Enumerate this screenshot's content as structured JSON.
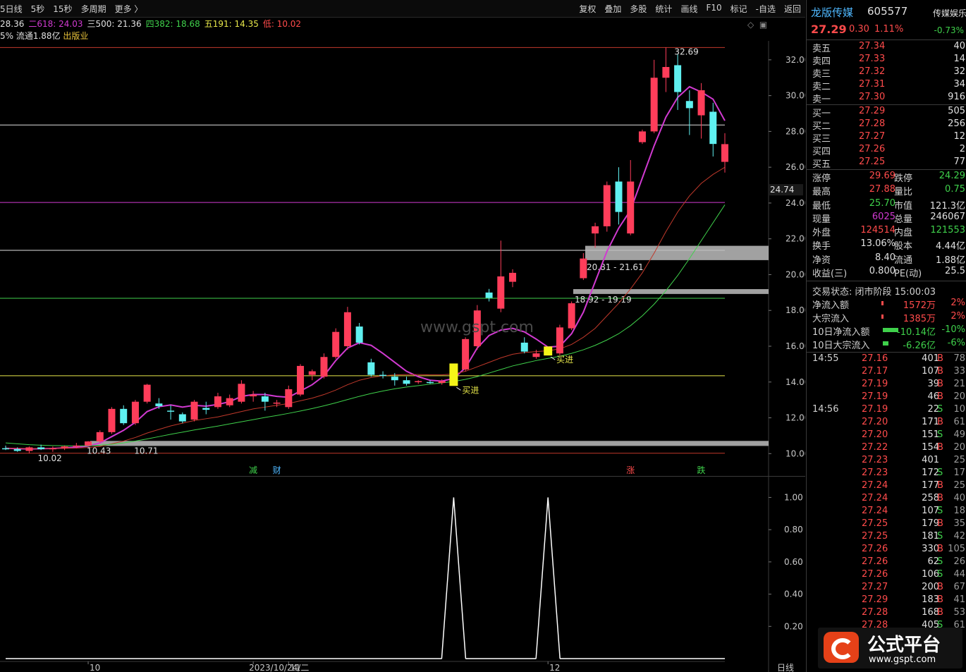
{
  "topbar": {
    "periods": [
      "5日线",
      "5秒",
      "15秒",
      "多周期",
      "更多 〉"
    ],
    "actions": [
      "复权",
      "叠加",
      "多股",
      "统计",
      "画线",
      "F10",
      "标记",
      "-自选",
      "返回"
    ]
  },
  "ma_line": [
    {
      "text": "28.36",
      "color": "#e0e0e0"
    },
    {
      "text": "二618: 24.03",
      "color": "#d13ad1"
    },
    {
      "text": "三500: 21.36",
      "color": "#e0e0e0"
    },
    {
      "text": "四382: 18.68",
      "color": "#3fd14b"
    },
    {
      "text": "五191: 14.35",
      "color": "#e8e84a"
    },
    {
      "text": "低: 10.02",
      "color": "#ff4b4b"
    }
  ],
  "info_line": {
    "text1": "5% 流通1.88亿",
    "text2": "出版业"
  },
  "watermark": "www.gspt.com",
  "chart_data": {
    "type": "candlestick",
    "y_axis_ticks": [
      "32.00",
      "30.00",
      "28.00",
      "26.00",
      "24.00",
      "22.00",
      "20.00",
      "18.00",
      "16.00",
      "14.00",
      "12.00",
      "10.00"
    ],
    "ylim": [
      9.5,
      32.9
    ],
    "price_marker": "24.74",
    "candles": [
      {
        "o": 10.3,
        "h": 10.45,
        "l": 10.2,
        "c": 10.25
      },
      {
        "o": 10.25,
        "h": 10.35,
        "l": 10.1,
        "c": 10.15
      },
      {
        "o": 10.15,
        "h": 10.4,
        "l": 10.02,
        "c": 10.35
      },
      {
        "o": 10.35,
        "h": 10.5,
        "l": 10.2,
        "c": 10.25
      },
      {
        "o": 10.25,
        "h": 10.4,
        "l": 10.1,
        "c": 10.3
      },
      {
        "o": 10.3,
        "h": 10.45,
        "l": 10.2,
        "c": 10.4
      },
      {
        "o": 10.4,
        "h": 10.6,
        "l": 10.3,
        "c": 10.45
      },
      {
        "o": 10.45,
        "h": 10.7,
        "l": 10.43,
        "c": 10.68
      },
      {
        "o": 10.68,
        "h": 11.3,
        "l": 10.6,
        "c": 11.2
      },
      {
        "o": 11.2,
        "h": 12.6,
        "l": 11.1,
        "c": 12.5
      },
      {
        "o": 12.5,
        "h": 12.7,
        "l": 11.6,
        "c": 11.7
      },
      {
        "o": 11.7,
        "h": 13.0,
        "l": 11.6,
        "c": 12.9
      },
      {
        "o": 12.9,
        "h": 13.9,
        "l": 12.8,
        "c": 13.85
      },
      {
        "o": 12.8,
        "h": 13.1,
        "l": 12.5,
        "c": 12.65
      },
      {
        "o": 12.4,
        "h": 12.7,
        "l": 11.9,
        "c": 12.35
      },
      {
        "o": 12.2,
        "h": 12.3,
        "l": 11.7,
        "c": 11.8
      },
      {
        "o": 11.9,
        "h": 13.0,
        "l": 11.8,
        "c": 12.9
      },
      {
        "o": 12.55,
        "h": 12.9,
        "l": 12.2,
        "c": 12.45
      },
      {
        "o": 12.6,
        "h": 13.4,
        "l": 12.5,
        "c": 13.2
      },
      {
        "o": 12.7,
        "h": 13.3,
        "l": 12.6,
        "c": 13.1
      },
      {
        "o": 12.9,
        "h": 14.1,
        "l": 12.8,
        "c": 13.9
      },
      {
        "o": 13.2,
        "h": 13.5,
        "l": 12.9,
        "c": 13.3
      },
      {
        "o": 13.2,
        "h": 13.4,
        "l": 12.4,
        "c": 12.9
      },
      {
        "o": 12.8,
        "h": 13.0,
        "l": 12.6,
        "c": 12.85
      },
      {
        "o": 12.6,
        "h": 13.8,
        "l": 12.5,
        "c": 13.6
      },
      {
        "o": 13.3,
        "h": 15.0,
        "l": 13.2,
        "c": 14.9
      },
      {
        "o": 14.4,
        "h": 14.7,
        "l": 14.1,
        "c": 14.6
      },
      {
        "o": 14.3,
        "h": 15.6,
        "l": 14.2,
        "c": 15.4
      },
      {
        "o": 15.4,
        "h": 17.0,
        "l": 15.3,
        "c": 16.8
      },
      {
        "o": 16.0,
        "h": 18.2,
        "l": 15.8,
        "c": 17.9
      },
      {
        "o": 17.1,
        "h": 17.3,
        "l": 16.1,
        "c": 16.2
      },
      {
        "o": 15.1,
        "h": 15.3,
        "l": 14.3,
        "c": 14.4
      },
      {
        "o": 14.4,
        "h": 14.6,
        "l": 14.2,
        "c": 14.35
      },
      {
        "o": 14.3,
        "h": 14.5,
        "l": 13.8,
        "c": 14.1
      },
      {
        "o": 14.1,
        "h": 14.3,
        "l": 13.8,
        "c": 13.9
      },
      {
        "o": 14.0,
        "h": 14.1,
        "l": 13.9,
        "c": 14.05
      },
      {
        "o": 14.0,
        "h": 14.1,
        "l": 13.9,
        "c": 13.95
      },
      {
        "o": 13.95,
        "h": 14.15,
        "l": 13.85,
        "c": 14.05
      },
      {
        "o": 13.9,
        "h": 14.9,
        "l": 13.85,
        "c": 14.8
      },
      {
        "o": 14.7,
        "h": 16.5,
        "l": 14.6,
        "c": 16.4
      },
      {
        "o": 16.0,
        "h": 18.3,
        "l": 15.8,
        "c": 18.0
      },
      {
        "o": 19.0,
        "h": 19.2,
        "l": 18.5,
        "c": 18.7
      },
      {
        "o": 18.1,
        "h": 21.9,
        "l": 17.9,
        "c": 19.9
      },
      {
        "o": 19.6,
        "h": 20.3,
        "l": 19.3,
        "c": 20.1
      },
      {
        "o": 16.2,
        "h": 16.5,
        "l": 15.6,
        "c": 15.7
      },
      {
        "o": 15.4,
        "h": 15.8,
        "l": 15.3,
        "c": 15.6
      },
      {
        "o": 15.6,
        "h": 15.9,
        "l": 15.5,
        "c": 15.75
      },
      {
        "o": 15.6,
        "h": 17.2,
        "l": 15.5,
        "c": 17.05
      },
      {
        "o": 17.0,
        "h": 18.5,
        "l": 16.9,
        "c": 18.4
      },
      {
        "o": 19.8,
        "h": 21.2,
        "l": 19.7,
        "c": 20.9
      },
      {
        "o": 22.3,
        "h": 22.9,
        "l": 21.5,
        "c": 22.7
      },
      {
        "o": 22.7,
        "h": 25.2,
        "l": 22.4,
        "c": 25.0
      },
      {
        "o": 25.2,
        "h": 26.0,
        "l": 22.8,
        "c": 23.5
      },
      {
        "o": 22.3,
        "h": 26.4,
        "l": 22.2,
        "c": 25.2
      },
      {
        "o": 27.4,
        "h": 28.1,
        "l": 27.3,
        "c": 28.0
      },
      {
        "o": 28.0,
        "h": 32.0,
        "l": 27.9,
        "c": 31.0
      },
      {
        "o": 31.0,
        "h": 32.69,
        "l": 30.2,
        "c": 31.6
      },
      {
        "o": 31.7,
        "h": 32.3,
        "l": 29.2,
        "c": 30.2
      },
      {
        "o": 29.7,
        "h": 30.3,
        "l": 27.8,
        "c": 29.3
      },
      {
        "o": 28.9,
        "h": 30.7,
        "l": 27.6,
        "c": 30.3
      },
      {
        "o": 29.1,
        "h": 29.6,
        "l": 26.6,
        "c": 27.3
      },
      {
        "o": 26.3,
        "h": 27.9,
        "l": 25.7,
        "c": 27.29
      }
    ],
    "horizontal_lines": [
      {
        "y": 32.69,
        "color": "#c0392b"
      },
      {
        "y": 28.36,
        "color": "#e0e0e0"
      },
      {
        "y": 24.03,
        "color": "#d13ad1"
      },
      {
        "y": 21.36,
        "color": "#e0e0e0"
      },
      {
        "y": 18.68,
        "color": "#3fd14b"
      },
      {
        "y": 14.35,
        "color": "#e8e84a"
      },
      {
        "y": 10.02,
        "color": "#c0392b"
      }
    ],
    "zones": [
      {
        "from": 20.81,
        "to": 21.61,
        "label": "20.81 - 21.61"
      },
      {
        "from": 18.92,
        "to": 19.19,
        "label": "18.92 - 19.19"
      },
      {
        "from": 10.43,
        "to": 10.71,
        "label": ""
      }
    ],
    "point_labels": [
      {
        "candle": 56,
        "price": 32.69,
        "text": "32.69"
      },
      {
        "candle": 2,
        "price": 10.02,
        "text": "10.02"
      },
      {
        "candle": 7,
        "price": 10.43,
        "text": "10.43"
      },
      {
        "candle": 10,
        "price": 10.43,
        "text": "10.71"
      }
    ],
    "buy_signals": [
      {
        "candle": 38,
        "text": "买进"
      },
      {
        "candle": 46,
        "text": "买进"
      }
    ],
    "bottom_markers": [
      {
        "candle": 21,
        "text": "减",
        "color": "#3fd14b"
      },
      {
        "candle": 23,
        "text": "财",
        "color": "#4fb8ff"
      },
      {
        "candle": 53,
        "text": "涨",
        "color": "#ff4b4b"
      },
      {
        "candle": 59,
        "text": "跌",
        "color": "#3fd14b"
      }
    ],
    "ma_series": [
      {
        "color": "#d13ad1",
        "values": [
          10.3,
          10.28,
          10.26,
          10.28,
          10.29,
          10.32,
          10.36,
          10.42,
          10.6,
          10.95,
          11.3,
          11.75,
          12.35,
          12.62,
          12.72,
          12.6,
          12.7,
          12.65,
          12.75,
          12.9,
          13.2,
          13.3,
          13.3,
          13.2,
          13.15,
          13.5,
          13.85,
          14.35,
          15.2,
          15.9,
          16.2,
          16.05,
          15.6,
          15.1,
          14.6,
          14.3,
          14.1,
          14.05,
          14.2,
          14.8,
          15.9,
          16.6,
          16.9,
          17.0,
          16.8,
          16.4,
          15.95,
          16.0,
          16.7,
          17.9,
          19.6,
          21.3,
          22.6,
          23.6,
          25.4,
          27.2,
          28.8,
          29.9,
          30.5,
          30.2,
          29.8,
          28.6
        ]
      },
      {
        "color": "#c0392b",
        "values": [
          10.3,
          10.3,
          10.29,
          10.29,
          10.29,
          10.3,
          10.31,
          10.34,
          10.4,
          10.55,
          10.7,
          10.9,
          11.15,
          11.35,
          11.55,
          11.7,
          11.85,
          11.95,
          12.05,
          12.2,
          12.35,
          12.5,
          12.6,
          12.7,
          12.8,
          12.95,
          13.1,
          13.3,
          13.55,
          13.85,
          14.1,
          14.25,
          14.35,
          14.4,
          14.42,
          14.42,
          14.4,
          14.4,
          14.45,
          14.6,
          14.85,
          15.1,
          15.35,
          15.55,
          15.65,
          15.7,
          15.75,
          15.85,
          16.1,
          16.5,
          17.0,
          17.7,
          18.4,
          19.2,
          20.1,
          21.2,
          22.4,
          23.5,
          24.4,
          25.1,
          25.6,
          26.0
        ]
      },
      {
        "color": "#3fd14b",
        "values": [
          10.6,
          10.55,
          10.5,
          10.47,
          10.45,
          10.44,
          10.43,
          10.44,
          10.47,
          10.52,
          10.6,
          10.7,
          10.82,
          10.95,
          11.08,
          11.2,
          11.32,
          11.43,
          11.54,
          11.66,
          11.78,
          11.9,
          12.02,
          12.13,
          12.25,
          12.38,
          12.52,
          12.67,
          12.84,
          13.02,
          13.2,
          13.36,
          13.5,
          13.62,
          13.72,
          13.8,
          13.88,
          13.95,
          14.03,
          14.15,
          14.3,
          14.5,
          14.7,
          14.9,
          15.05,
          15.2,
          15.32,
          15.44,
          15.6,
          15.8,
          16.05,
          16.35,
          16.7,
          17.15,
          17.7,
          18.35,
          19.1,
          19.95,
          20.9,
          21.9,
          22.9,
          23.9
        ]
      }
    ],
    "sub_chart": {
      "y_axis_ticks": [
        "1.00",
        "0.80",
        "0.60",
        "0.40",
        "0.20"
      ],
      "ylim": [
        0,
        1.05
      ],
      "values": [
        0,
        0,
        0,
        0,
        0,
        0,
        0,
        0,
        0,
        0,
        0,
        0,
        0,
        0,
        0,
        0,
        0,
        0,
        0,
        0,
        0,
        0,
        0,
        0,
        0,
        0,
        0,
        0,
        0,
        0,
        0,
        0,
        0,
        0,
        0,
        0,
        0,
        0,
        1,
        0,
        0,
        0,
        0,
        0,
        0,
        0,
        1,
        0,
        0,
        0,
        0,
        0,
        0,
        0,
        0,
        0,
        0,
        0,
        0,
        0,
        0,
        0
      ]
    },
    "x_axis_labels": [
      {
        "candle": 7,
        "text": "10"
      },
      {
        "candle": 21,
        "text": "2023/10/24/二"
      },
      {
        "candle": 24,
        "text": "11"
      },
      {
        "candle": 46,
        "text": "12"
      }
    ],
    "sub_corner_label": "日线"
  },
  "quote": {
    "name": "龙版传媒",
    "code": "605577",
    "sector": "传媒娱乐",
    "price": "27.29",
    "change": "0.30",
    "change_pct": "1.11%",
    "sector_pct": "-0.73%"
  },
  "order_book": {
    "asks": [
      {
        "label": "卖五",
        "price": "27.34",
        "vol": "40"
      },
      {
        "label": "卖四",
        "price": "27.33",
        "vol": "14"
      },
      {
        "label": "卖三",
        "price": "27.32",
        "vol": "32"
      },
      {
        "label": "卖二",
        "price": "27.31",
        "vol": "34"
      },
      {
        "label": "卖一",
        "price": "27.30",
        "vol": "916"
      }
    ],
    "bids": [
      {
        "label": "买一",
        "price": "27.29",
        "vol": "505"
      },
      {
        "label": "买二",
        "price": "27.28",
        "vol": "256"
      },
      {
        "label": "买三",
        "price": "27.27",
        "vol": "12"
      },
      {
        "label": "买四",
        "price": "27.26",
        "vol": "2"
      },
      {
        "label": "买五",
        "price": "27.25",
        "vol": "77"
      }
    ]
  },
  "stats": [
    {
      "l1": "涨停",
      "v1": "29.69",
      "c1": "#ff4b4b",
      "l2": "跌停",
      "v2": "24.29",
      "c2": "#3fd14b"
    },
    {
      "l1": "最高",
      "v1": "27.88",
      "c1": "#ff4b4b",
      "l2": "量比",
      "v2": "0.75",
      "c2": "#3fd14b"
    },
    {
      "l1": "最低",
      "v1": "25.70",
      "c1": "#3fd14b",
      "l2": "市值",
      "v2": "121.3亿",
      "c2": "#e0e0e0"
    },
    {
      "l1": "现量",
      "v1": "6025",
      "c1": "#d13ad1",
      "l2": "总量",
      "v2": "246067",
      "c2": "#e0e0e0"
    },
    {
      "l1": "外盘",
      "v1": "124514",
      "c1": "#ff4b4b",
      "l2": "内盘",
      "v2": "121553",
      "c2": "#3fd14b"
    },
    {
      "l1": "换手",
      "v1": "13.06%",
      "c1": "#e0e0e0",
      "l2": "股本",
      "v2": "4.44亿",
      "c2": "#e0e0e0"
    },
    {
      "l1": "净资",
      "v1": "8.40",
      "c1": "#e0e0e0",
      "l2": "流通",
      "v2": "1.88亿",
      "c2": "#e0e0e0"
    },
    {
      "l1": "收益(三)",
      "v1": "0.800",
      "c1": "#e0e0e0",
      "l2": "PE(动)",
      "v2": "25.5",
      "c2": "#e0e0e0"
    }
  ],
  "trade_status": "交易状态: 闭市阶段 15:00:03",
  "fund_flow": [
    {
      "label": "净流入额",
      "amount": "1572万",
      "pct": "2%",
      "color": "#ff4b4b",
      "bar": 0.03,
      "dir": "in"
    },
    {
      "label": "大宗流入",
      "amount": "1385万",
      "pct": "2%",
      "color": "#ff4b4b",
      "bar": 0.03,
      "dir": "in"
    },
    {
      "label": "10日净流入额",
      "amount": "-10.14亿",
      "pct": "-10%",
      "color": "#3fd14b",
      "bar": 0.28,
      "dir": "out"
    },
    {
      "label": "10日大宗流入",
      "amount": "-6.26亿",
      "pct": "-6%",
      "color": "#3fd14b",
      "bar": 0.1,
      "dir": "out"
    }
  ],
  "ticks": [
    {
      "time": "14:55",
      "price": "27.16",
      "vol": "401",
      "bs": "B",
      "cnt": "78"
    },
    {
      "time": "",
      "price": "27.17",
      "vol": "107",
      "bs": "B",
      "cnt": "33"
    },
    {
      "time": "",
      "price": "27.19",
      "vol": "39",
      "bs": "B",
      "cnt": "21"
    },
    {
      "time": "",
      "price": "27.19",
      "vol": "46",
      "bs": "B",
      "cnt": "20"
    },
    {
      "time": "14:56",
      "price": "27.19",
      "vol": "22",
      "bs": "S",
      "cnt": "10"
    },
    {
      "time": "",
      "price": "27.20",
      "vol": "171",
      "bs": "B",
      "cnt": "61"
    },
    {
      "time": "",
      "price": "27.20",
      "vol": "151",
      "bs": "S",
      "cnt": "49"
    },
    {
      "time": "",
      "price": "27.22",
      "vol": "154",
      "bs": "B",
      "cnt": "20"
    },
    {
      "time": "",
      "price": "27.23",
      "vol": "401",
      "bs": "",
      "cnt": "25"
    },
    {
      "time": "",
      "price": "27.23",
      "vol": "172",
      "bs": "S",
      "cnt": "17"
    },
    {
      "time": "",
      "price": "27.24",
      "vol": "177",
      "bs": "B",
      "cnt": "25"
    },
    {
      "time": "",
      "price": "27.24",
      "vol": "258",
      "bs": "B",
      "cnt": "40"
    },
    {
      "time": "",
      "price": "27.24",
      "vol": "107",
      "bs": "S",
      "cnt": "18"
    },
    {
      "time": "",
      "price": "27.25",
      "vol": "179",
      "bs": "B",
      "cnt": "35"
    },
    {
      "time": "",
      "price": "27.25",
      "vol": "181",
      "bs": "S",
      "cnt": "42"
    },
    {
      "time": "",
      "price": "27.26",
      "vol": "330",
      "bs": "B",
      "cnt": "105"
    },
    {
      "time": "",
      "price": "27.26",
      "vol": "62",
      "bs": "S",
      "cnt": "26"
    },
    {
      "time": "",
      "price": "27.26",
      "vol": "106",
      "bs": "S",
      "cnt": "44"
    },
    {
      "time": "",
      "price": "27.27",
      "vol": "200",
      "bs": "B",
      "cnt": "67"
    },
    {
      "time": "",
      "price": "27.29",
      "vol": "183",
      "bs": "B",
      "cnt": "41"
    },
    {
      "time": "",
      "price": "27.28",
      "vol": "168",
      "bs": "B",
      "cnt": "53"
    },
    {
      "time": "",
      "price": "27.28",
      "vol": "405",
      "bs": "S",
      "cnt": "61"
    }
  ],
  "logo": {
    "title": "公式平台",
    "url": "www.gspt.com"
  }
}
